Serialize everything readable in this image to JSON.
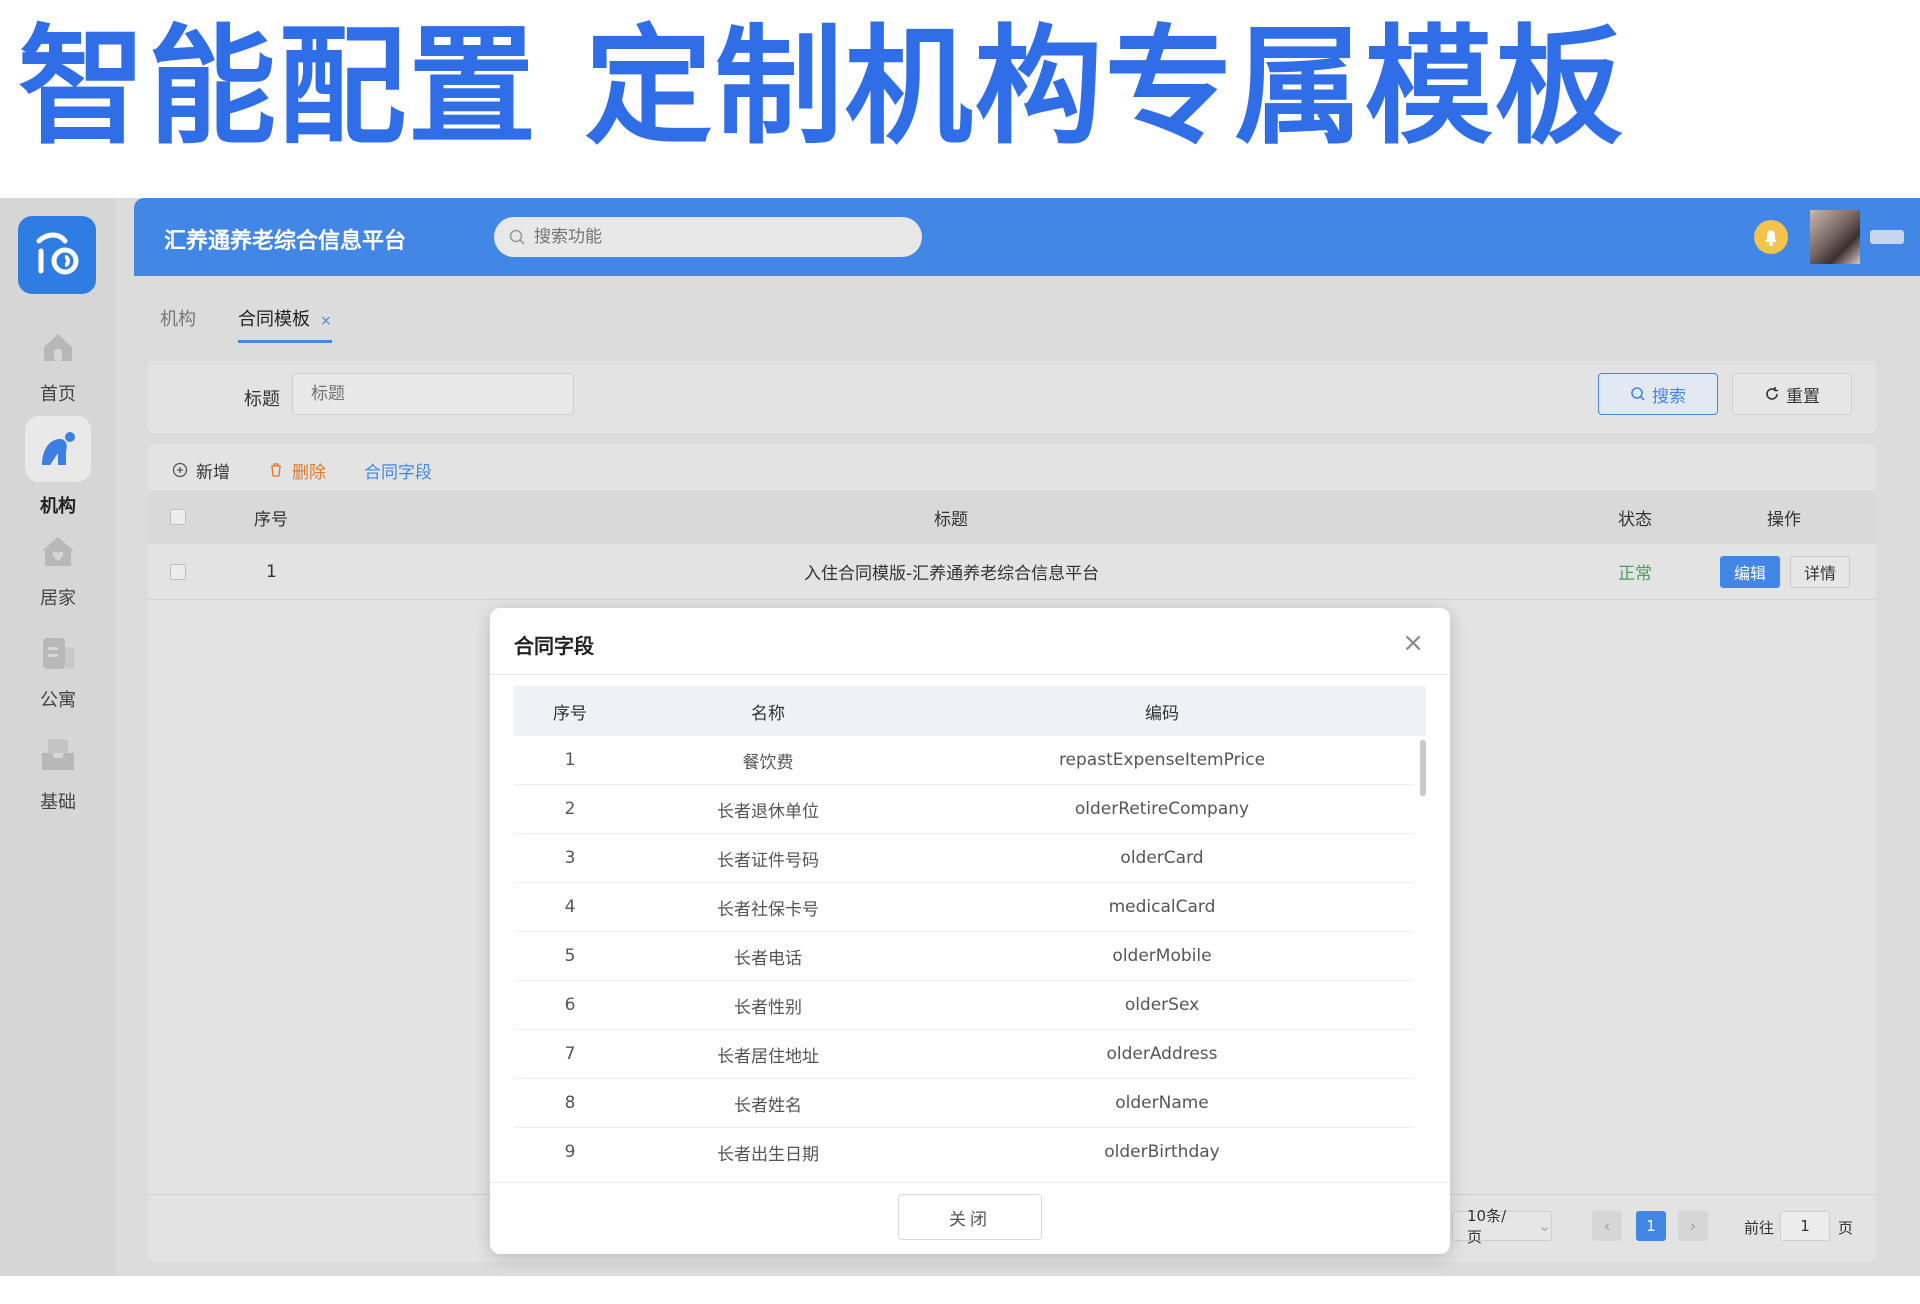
{
  "hero": {
    "text": "智能配置 定制机构专属模板"
  },
  "sidebar": {
    "items": [
      {
        "label": "首页",
        "icon": "home-icon"
      },
      {
        "label": "机构",
        "icon": "institution-icon",
        "active": true
      },
      {
        "label": "居家",
        "icon": "house-heart-icon"
      },
      {
        "label": "公寓",
        "icon": "apartment-icon"
      },
      {
        "label": "基础",
        "icon": "inbox-icon"
      }
    ]
  },
  "header": {
    "title": "汇养通养老综合信息平台",
    "search_placeholder": "搜索功能"
  },
  "tabs": [
    {
      "label": "机构"
    },
    {
      "label": "合同模板",
      "active": true,
      "close": "×"
    }
  ],
  "filter": {
    "label": "标题",
    "placeholder": "标题",
    "search_label": "搜索",
    "reset_label": "重置"
  },
  "toolbar": {
    "add_label": "新增",
    "delete_label": "删除",
    "fields_label": "合同字段"
  },
  "table": {
    "columns": [
      "序号",
      "标题",
      "状态",
      "操作"
    ],
    "rows": [
      {
        "index": "1",
        "title": "入住合同模版-汇养通养老综合信息平台",
        "status": "正常",
        "edit": "编辑",
        "detail": "详情"
      }
    ]
  },
  "pager": {
    "page_size": "10条/页",
    "current": "1",
    "goto_label": "前往",
    "goto_value": "1",
    "page_unit": "页"
  },
  "modal": {
    "title": "合同字段",
    "columns": [
      "序号",
      "名称",
      "编码"
    ],
    "rows": [
      {
        "index": "1",
        "name": "餐饮费",
        "code": "repastExpenseItemPrice"
      },
      {
        "index": "2",
        "name": "长者退休单位",
        "code": "olderRetireCompany"
      },
      {
        "index": "3",
        "name": "长者证件号码",
        "code": "olderCard"
      },
      {
        "index": "4",
        "name": "长者社保卡号",
        "code": "medicalCard"
      },
      {
        "index": "5",
        "name": "长者电话",
        "code": "olderMobile"
      },
      {
        "index": "6",
        "name": "长者性别",
        "code": "olderSex"
      },
      {
        "index": "7",
        "name": "长者居住地址",
        "code": "olderAddress"
      },
      {
        "index": "8",
        "name": "长者姓名",
        "code": "olderName"
      },
      {
        "index": "9",
        "name": "长者出生日期",
        "code": "olderBirthday"
      }
    ],
    "close_label": "关闭"
  },
  "colors": {
    "primary": "#4387e6",
    "hero": "#2f6ee6",
    "danger": "#e07a2a",
    "success": "#4aa05a"
  }
}
